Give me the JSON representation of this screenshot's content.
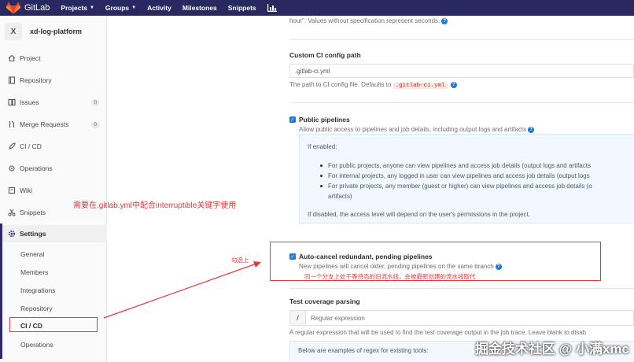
{
  "nav": {
    "brand": "GitLab",
    "items": [
      {
        "label": "Projects",
        "dropdown": true
      },
      {
        "label": "Groups",
        "dropdown": true
      },
      {
        "label": "Activity",
        "dropdown": false
      },
      {
        "label": "Milestones",
        "dropdown": false
      },
      {
        "label": "Snippets",
        "dropdown": false
      }
    ],
    "chart_icon": "bar-chart-icon"
  },
  "sidebar": {
    "avatar_letter": "X",
    "project_name": "xd-log-platform",
    "items": [
      {
        "label": "Project",
        "icon": "home-icon"
      },
      {
        "label": "Repository",
        "icon": "book-icon"
      },
      {
        "label": "Issues",
        "icon": "issues-icon",
        "badge": "0"
      },
      {
        "label": "Merge Requests",
        "icon": "merge-icon",
        "badge": "0"
      },
      {
        "label": "CI / CD",
        "icon": "rocket-icon"
      },
      {
        "label": "Operations",
        "icon": "cloud-gear-icon"
      },
      {
        "label": "Wiki",
        "icon": "wiki-icon"
      },
      {
        "label": "Snippets",
        "icon": "scissors-icon"
      },
      {
        "label": "Settings",
        "icon": "gear-icon"
      }
    ],
    "settings_sub": [
      "General",
      "Members",
      "Integrations",
      "Repository",
      "CI / CD",
      "Operations"
    ]
  },
  "content": {
    "top_help": "hour\". Values without specification represent seconds.",
    "custom_ci": {
      "label": "Custom CI config path",
      "value": ".gitlab-ci.yml",
      "help_prefix": "The path to CI config file. Defaults to",
      "help_code": ".gitlab-ci.yml"
    },
    "public_pipelines": {
      "label": "Public pipelines",
      "help": "Allow public access to pipelines and job details, including output logs and artifacts",
      "info_title": "If enabled:",
      "bullets": [
        "For public projects, anyone can view pipelines and access job details (output logs and artifacts",
        "For internal projects, any logged in user can view pipelines and access job details (output logs",
        "For private projects, any member (guest or higher) can view pipelines and access job details (o"
      ],
      "bullet3_cont": "artifacts)",
      "info_footer": "If disabled, the access level will depend on the user's permissions in the project."
    },
    "auto_cancel": {
      "label": "Auto-cancel redundant, pending pipelines",
      "help": "New pipelines will cancel older, pending pipelines on the same branch",
      "note": "同一个分支上处于等待态的旧流水线，会被最新创建的流水线取代"
    },
    "coverage": {
      "label": "Test coverage parsing",
      "prefix": "/",
      "placeholder": "Regular expression",
      "help": "A regular expression that will be used to find the test coverage output in the job trace. Leave blank to disab",
      "examples": "Below are examples of regex for existing tools:"
    }
  },
  "annotations": {
    "note_left": "需要在.gitlab.yml中配合interruptible关键字使用",
    "check_hint": "勾选上",
    "watermark": "掘金技术社区 @ 小满xmc"
  },
  "colors": {
    "nav_bg": "#292961",
    "link_blue": "#1f78d1",
    "annotation_red": "#e0393e"
  }
}
